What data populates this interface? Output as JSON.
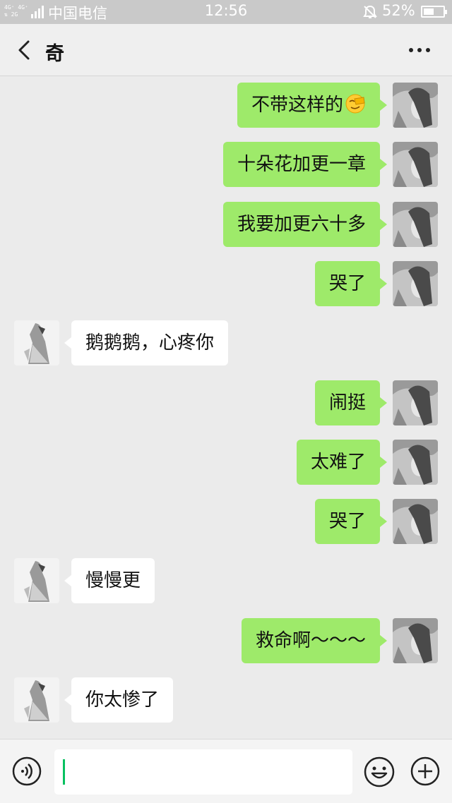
{
  "status_bar": {
    "network_label": "4G⁺ 4G⁺\n⇅ 2G",
    "carrier": "中国电信",
    "time": "12:56",
    "battery_percent_label": "52%",
    "battery_level": 0.52,
    "icons": [
      "signal-icon",
      "bell-mute-icon",
      "battery-icon"
    ]
  },
  "header": {
    "title": "奇",
    "icons": [
      "back-chevron-icon",
      "more-dots-icon"
    ]
  },
  "messages": [
    {
      "from": "me",
      "text": "不带这样的",
      "emoji": "face-palm-emoji"
    },
    {
      "from": "me",
      "text": "十朵花加更一章"
    },
    {
      "from": "me",
      "text": "我要加更六十多"
    },
    {
      "from": "me",
      "text": "哭了"
    },
    {
      "from": "them",
      "text": "鹅鹅鹅，心疼你"
    },
    {
      "from": "me",
      "text": "闹挺"
    },
    {
      "from": "me",
      "text": "太难了"
    },
    {
      "from": "me",
      "text": "哭了"
    },
    {
      "from": "them",
      "text": "慢慢更"
    },
    {
      "from": "me",
      "text": "救命啊～～～"
    },
    {
      "from": "them",
      "text": "你太惨了"
    }
  ],
  "input_bar": {
    "value": "",
    "icons": [
      "voice-icon",
      "emoji-face-icon",
      "plus-icon"
    ]
  },
  "colors": {
    "outgoing_bubble": "#9eea6a",
    "incoming_bubble": "#ffffff",
    "background": "#ebebeb",
    "caret": "#07c160"
  }
}
